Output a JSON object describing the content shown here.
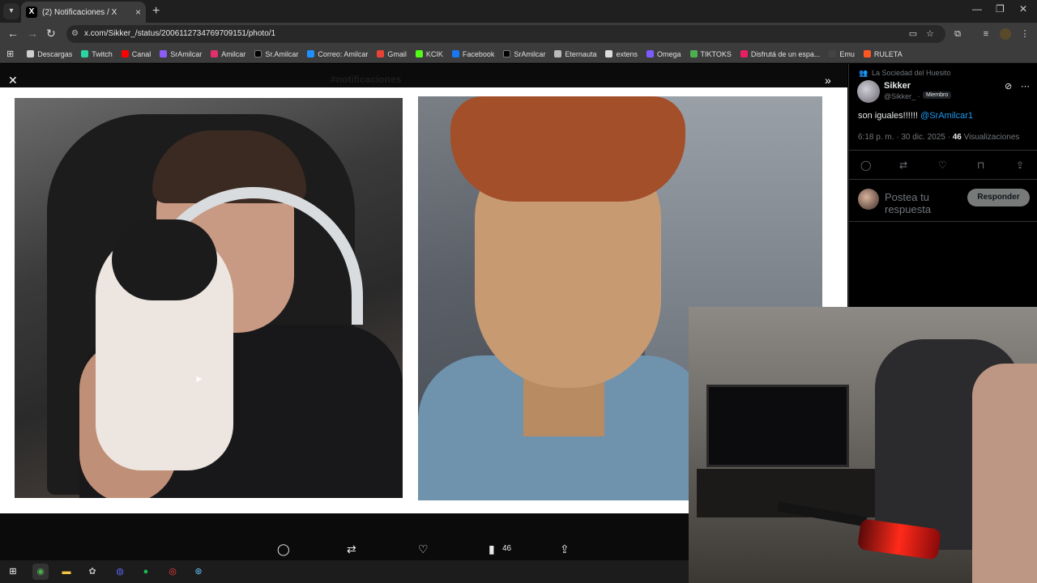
{
  "browser": {
    "tab_title": "(2) Notificaciones / X",
    "tab_favicon": "x-logo-icon",
    "url": "x.com/Sikker_/status/2006112734769709151/photo/1"
  },
  "bookmarks": [
    {
      "label": "Descargas",
      "color": "#cfcfcf"
    },
    {
      "label": "Twitch",
      "color": "#2bd4a4"
    },
    {
      "label": "Canal",
      "color": "#ff0000"
    },
    {
      "label": "SrAmilcar",
      "color": "#8b5cf6"
    },
    {
      "label": "Amilcar",
      "color": "#e1306c"
    },
    {
      "label": "Sr.Amilcar",
      "color": "#000000"
    },
    {
      "label": "Correo: Amilcar",
      "color": "#1e90ff"
    },
    {
      "label": "Gmail",
      "color": "#ea4335"
    },
    {
      "label": "KCIK",
      "color": "#53fc18"
    },
    {
      "label": "Facebook",
      "color": "#1877f2"
    },
    {
      "label": "SrAmilcar",
      "color": "#000000"
    },
    {
      "label": "Eternauta",
      "color": "#bbbbbb"
    },
    {
      "label": "extens",
      "color": "#dddddd"
    },
    {
      "label": "Omega",
      "color": "#7c5cff"
    },
    {
      "label": "TIKTOKS",
      "color": "#4caf50"
    },
    {
      "label": "Disfrutá de un espa...",
      "color": "#e91e63"
    },
    {
      "label": "Emu",
      "color": "#444444"
    },
    {
      "label": "RULETA",
      "color": "#ff5722"
    }
  ],
  "viewer": {
    "ghost_header": "#notificaciones",
    "views_count": "46"
  },
  "tweet": {
    "community": "La Sociedad del Huesito",
    "author_name": "Sikker",
    "author_handle": "@Sikker_ ·",
    "member_badge": "Miembro",
    "text": "son iguales!!!!!! ",
    "mention": "@SrAmilcar1",
    "timestamp": "6:18 p. m. · 30 dic. 2025 · ",
    "views": "46",
    "views_label": " Visualizaciones",
    "reply_placeholder": "Postea tu respuesta",
    "reply_button": "Responder"
  }
}
